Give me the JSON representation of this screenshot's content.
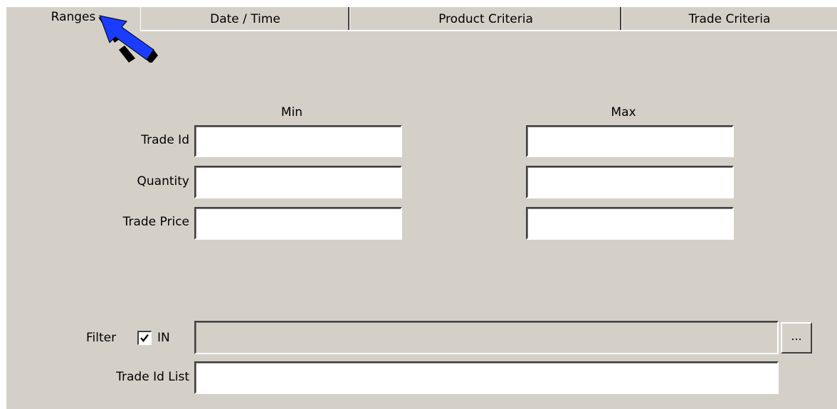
{
  "tabs": [
    {
      "label": "Ranges",
      "active": true
    },
    {
      "label": "Date / Time",
      "active": false
    },
    {
      "label": "Product Criteria",
      "active": false
    },
    {
      "label": "Trade Criteria",
      "active": false
    }
  ],
  "ranges": {
    "min_header": "Min",
    "max_header": "Max",
    "rows": [
      {
        "label": "Trade Id",
        "min": "",
        "max": ""
      },
      {
        "label": "Quantity",
        "min": "",
        "max": ""
      },
      {
        "label": "Trade Price",
        "min": "",
        "max": ""
      }
    ]
  },
  "filter": {
    "label": "Filter",
    "in_label": "IN",
    "in_checked": true,
    "value": "",
    "browse_label": "..."
  },
  "trade_id_list": {
    "label": "Trade Id List",
    "value": ""
  },
  "annotation": {
    "arrow_color": "#1a3cff",
    "icon": "pointer-arrow"
  }
}
